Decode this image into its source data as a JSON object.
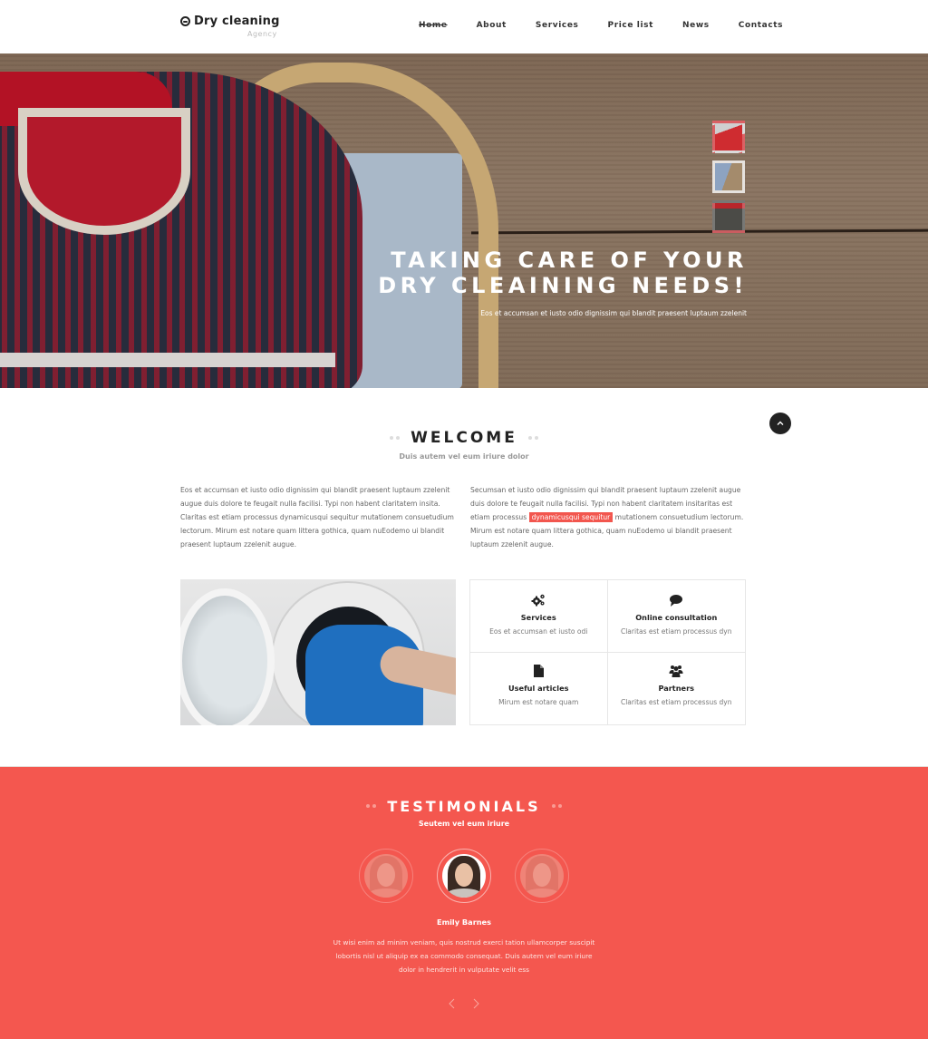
{
  "header": {
    "logo_title": "Dry cleaning",
    "logo_subtitle": "Agency",
    "nav": [
      {
        "label": "Home",
        "active": true
      },
      {
        "label": "About",
        "active": false
      },
      {
        "label": "Services",
        "active": false
      },
      {
        "label": "Price list",
        "active": false
      },
      {
        "label": "News",
        "active": false
      },
      {
        "label": "Contacts",
        "active": false
      }
    ]
  },
  "hero": {
    "title_line1": "TAKING CARE OF YOUR",
    "title_line2": "DRY CLEAINING NEEDS!",
    "subtitle": "Eos et accumsan et iusto odio dignissim qui blandit praesent luptaum zzelenit",
    "thumbnails": [
      {
        "name": "red-shirt-on-hanger",
        "active": false
      },
      {
        "name": "sweater-in-basket",
        "active": true
      },
      {
        "name": "laundromat-machines",
        "active": false
      }
    ]
  },
  "back_to_top": {
    "icon": "chevron-up-icon"
  },
  "welcome": {
    "title": "WELCOME",
    "subtitle": "Duis autem vel eum iriure dolor",
    "left_text": "Eos et accumsan et iusto odio dignissim qui blandit praesent luptaum zzelenit augue duis dolore te feugait nulla facilisi. Typi non habent claritatem insita. Claritas est etiam processus dynamicusqui sequitur mutationem consuetudium lectorum. Mirum est notare quam littera gothica, quam nuEodemo ui blandit praesent luptaum zzelenit augue.",
    "right_text_before": "Secumsan et iusto odio dignissim qui blandit praesent luptaum zzelenit augue duis dolore te feugait nulla facilisi. Typi non habent claritatem insitaritas est etiam processus ",
    "right_text_highlight": "dynamicusqui sequitur",
    "right_text_after": " mutationem consuetudium lectorum. Mirum est notare quam littera gothica, quam nuEodemo ui blandit praesent luptaum zzelenit augue.",
    "accent_color": "#f2564e"
  },
  "features": [
    {
      "icon": "gears-icon",
      "title": "Services",
      "text": "Eos et accumsan et iusto odi"
    },
    {
      "icon": "speech-bubble-icon",
      "title": "Online consultation",
      "text": "Claritas est etiam processus dyn"
    },
    {
      "icon": "document-icon",
      "title": "Useful articles",
      "text": "Mirum est notare quam"
    },
    {
      "icon": "group-icon",
      "title": "Partners",
      "text": "Claritas est etiam processus dyn"
    }
  ],
  "testimonials": {
    "title": "TESTIMONIALS",
    "subtitle": "Seutem vel eum iriure",
    "background_color": "#f4574f",
    "avatars": [
      {
        "name": "testimonial-avatar-1",
        "active": false
      },
      {
        "name": "testimonial-avatar-emily",
        "active": true
      },
      {
        "name": "testimonial-avatar-3",
        "active": false
      }
    ],
    "active_name": "Emily Barnes",
    "active_text": "Ut wisi enim ad minim veniam, quis nostrud exerci tation ullamcorper suscipit lobortis nisl ut aliquip ex ea commodo consequat. Duis autem vel eum iriure dolor in hendrerit in vulputate velit ess",
    "prev_icon": "chevron-left-icon",
    "next_icon": "chevron-right-icon"
  }
}
